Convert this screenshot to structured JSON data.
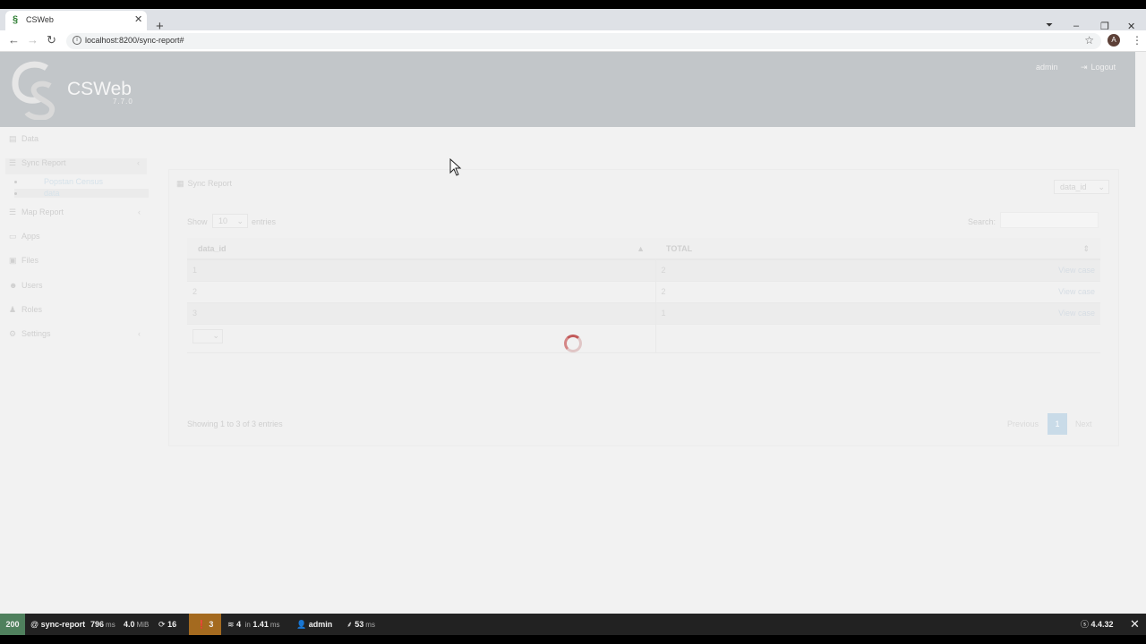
{
  "browser": {
    "tab_title": "CSWeb",
    "url": "localhost:8200/sync-report#",
    "profile_initial": "A"
  },
  "header": {
    "brand": "CSWeb",
    "version": "7.7.0",
    "user": "admin",
    "logout": "Logout"
  },
  "sidebar": {
    "items": [
      {
        "label": "Data",
        "icon": "database-icon"
      },
      {
        "label": "Sync Report",
        "icon": "table-icon"
      },
      {
        "label": "Map Report",
        "icon": "table-icon"
      },
      {
        "label": "Apps",
        "icon": "laptop-icon"
      },
      {
        "label": "Files",
        "icon": "folder-icon"
      },
      {
        "label": "Users",
        "icon": "users-icon"
      },
      {
        "label": "Roles",
        "icon": "user-icon"
      },
      {
        "label": "Settings",
        "icon": "gear-icon"
      }
    ],
    "sub_items": [
      "Popstan Census",
      "data"
    ]
  },
  "panel": {
    "title": "Sync Report",
    "group_select": "data_id",
    "show_label": "Show",
    "page_length": "10",
    "entries_label": "entries",
    "search_label": "Search:",
    "columns": [
      "data_id",
      "TOTAL"
    ],
    "rows": [
      {
        "id": "1",
        "total": "2",
        "link": "View case"
      },
      {
        "id": "2",
        "total": "2",
        "link": "View case"
      },
      {
        "id": "3",
        "total": "1",
        "link": "View case"
      }
    ],
    "info": "Showing 1 to 3 of 3 entries",
    "pager": {
      "previous": "Previous",
      "page": "1",
      "next": "Next"
    }
  },
  "debug_bar": {
    "status": "200",
    "route": "sync-report",
    "time": "796",
    "time_unit": "ms",
    "memory": "4.0",
    "memory_unit": "MiB",
    "requests": "16",
    "warnings": "3",
    "db_queries": "4",
    "db_in": "in",
    "db_time": "1.41",
    "db_time_unit": "ms",
    "user": "admin",
    "twig_time": "53",
    "twig_unit": "ms",
    "symfony_version": "4.4.32"
  }
}
